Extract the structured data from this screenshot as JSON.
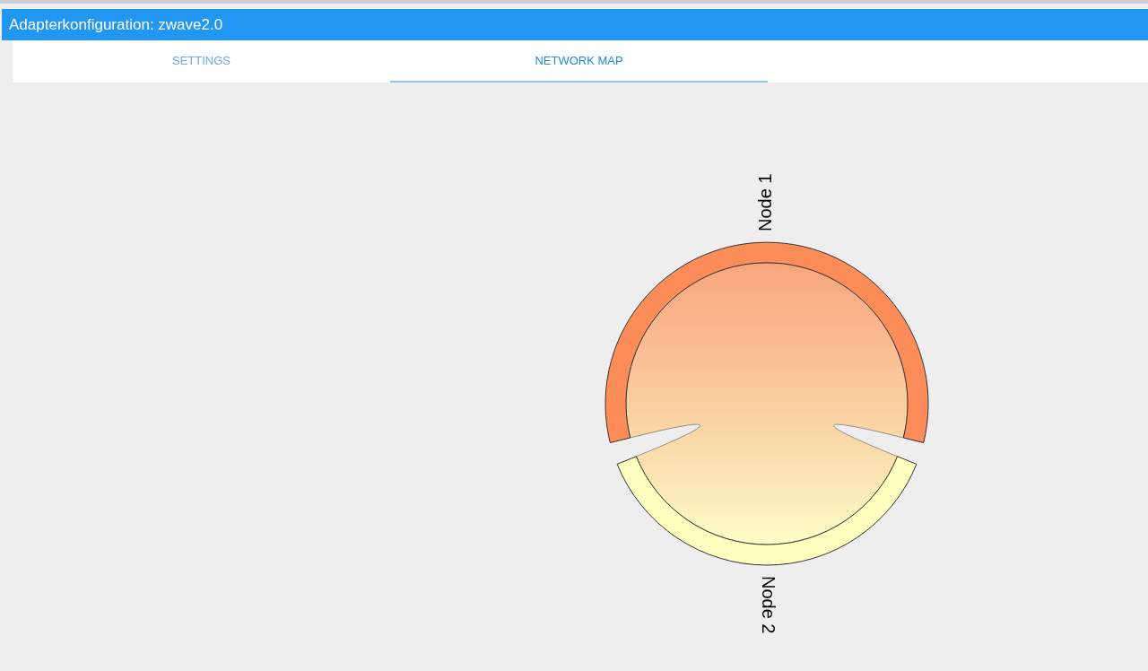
{
  "window": {
    "title": "Adapterkonfiguration: zwave2.0"
  },
  "tabs": [
    {
      "label": "SETTINGS",
      "selected": false
    },
    {
      "label": "NETWORK MAP",
      "selected": true
    }
  ],
  "network_map": {
    "nodes": [
      {
        "label": "Node 1",
        "color": "#fc8d59"
      },
      {
        "label": "Node 2",
        "color": "#ffffbf"
      }
    ]
  }
}
